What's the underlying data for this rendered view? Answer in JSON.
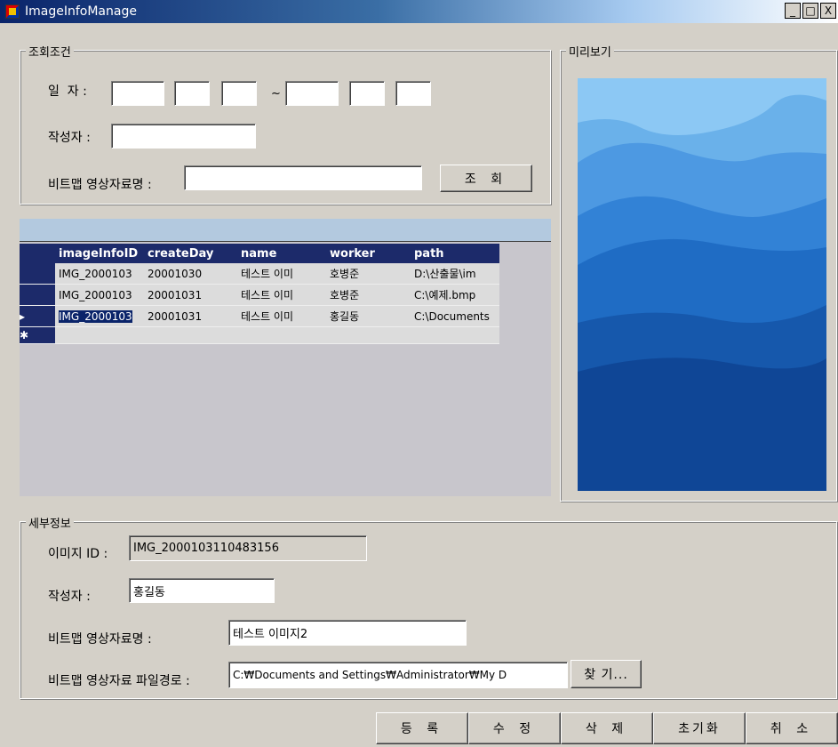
{
  "window": {
    "title": "ImageInfoManage",
    "min": "_",
    "max": "□",
    "close": "X"
  },
  "search": {
    "legend": "조회조건",
    "date_label": "일  자 :",
    "tilde": "~",
    "date_from": [
      "",
      "",
      ""
    ],
    "date_to": [
      "",
      "",
      ""
    ],
    "author_label": "작성자 :",
    "author_value": "",
    "name_label": "비트맵 영상자료명 :",
    "name_value": "",
    "search_button": "조 회"
  },
  "preview": {
    "legend": "미리보기"
  },
  "grid": {
    "columns": [
      "imageInfoID",
      "createDay",
      "name",
      "worker",
      "path"
    ],
    "rows": [
      {
        "indicator": "",
        "cells": [
          "IMG_2000103",
          "20001030",
          "테스트 이미",
          "호병준",
          "D:\\산출물\\im"
        ]
      },
      {
        "indicator": "",
        "cells": [
          "IMG_2000103",
          "20001031",
          "테스트 이미",
          "호병준",
          "C:\\예제.bmp"
        ]
      },
      {
        "indicator": "▸",
        "cells": [
          "IMG_2000103",
          "20001031",
          "테스트 이미",
          "홍길동",
          "C:\\Documents"
        ]
      }
    ],
    "new_row_indicator": "✱"
  },
  "detail": {
    "legend": "세부정보",
    "id_label": "이미지 ID :",
    "id_value": "IMG_2000103110483156",
    "author_label": "작성자 :",
    "author_value": "홍길동",
    "name_label": "비트맵 영상자료명 :",
    "name_value": "테스트 이미지2",
    "path_label": "비트맵 영상자료 파일경로 :",
    "path_value": "C:₩Documents and Settings₩Administrator₩My D",
    "find_button": "찾 기..."
  },
  "actions": {
    "register": "등 록",
    "modify": "수 정",
    "delete": "삭 제",
    "reset": "초기화",
    "cancel": "취 소"
  }
}
